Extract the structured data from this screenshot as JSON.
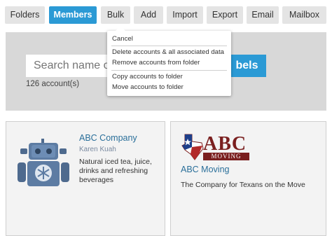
{
  "toolbar": {
    "tabs": [
      {
        "label": "Folders"
      },
      {
        "label": "Members"
      },
      {
        "label": "Bulk"
      },
      {
        "label": "Add"
      },
      {
        "label": "Import"
      },
      {
        "label": "Export"
      },
      {
        "label": "Email"
      },
      {
        "label": "Mailbox"
      }
    ],
    "active_tab": "Members"
  },
  "search": {
    "placeholder": "Search name or",
    "labels_button": "bels",
    "count_text": "126 account(s)"
  },
  "bulk_menu": {
    "items": [
      {
        "label": "Cancel"
      },
      {
        "label": "Delete accounts & all associated data"
      },
      {
        "label": "Remove accounts from folder"
      },
      {
        "label": "Copy accounts to folder"
      },
      {
        "label": "Move accounts to folder"
      }
    ]
  },
  "cards": [
    {
      "title": "ABC Company",
      "subtitle": "Karen Kuah",
      "description": "Natural iced tea, juice, drinks and refreshing beverages",
      "image_icon": "robot-avatar"
    },
    {
      "title": "ABC Moving",
      "description": "The Company for Texans on the Move",
      "logo": {
        "text": "ABC",
        "tagline": "MOVING"
      }
    }
  ],
  "colors": {
    "accent": "#2b9ad5",
    "tab_bg": "#e4e4e4",
    "band_bg": "#d8d8d8",
    "card_bg": "#f3f3f3",
    "link": "#2a6f9a",
    "logo_red": "#7a1f1f"
  }
}
